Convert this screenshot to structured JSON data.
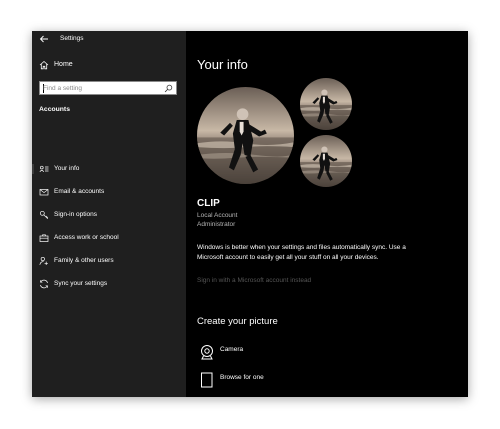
{
  "window": {
    "title": "Settings"
  },
  "sidebar": {
    "home_label": "Home",
    "search": {
      "placeholder": "Find a setting"
    },
    "section_title": "Accounts",
    "items": [
      {
        "label": "Your info",
        "icon": "person-card-icon",
        "selected": true
      },
      {
        "label": "Email & accounts",
        "icon": "mail-icon",
        "selected": false
      },
      {
        "label": "Sign-in options",
        "icon": "key-icon",
        "selected": false
      },
      {
        "label": "Access work or school",
        "icon": "briefcase-icon",
        "selected": false
      },
      {
        "label": "Family & other users",
        "icon": "person-add-icon",
        "selected": false
      },
      {
        "label": "Sync your settings",
        "icon": "sync-icon",
        "selected": false
      }
    ]
  },
  "main": {
    "title": "Your info",
    "user": {
      "name": "CLIP",
      "account_type": "Local Account",
      "role": "Administrator"
    },
    "sync_message": "Windows is better when your settings and files automatically sync. Use a Microsoft account to easily get all your stuff on all your devices.",
    "ms_link": "Sign in with a Microsoft account instead",
    "create_title": "Create your picture",
    "options": [
      {
        "label": "Camera",
        "icon": "camera-icon"
      },
      {
        "label": "Browse for one",
        "icon": "file-icon"
      }
    ]
  },
  "colors": {
    "sidebar_bg": "#1f1f1f",
    "main_bg": "#000000",
    "text": "#ffffff",
    "muted_text": "#b5b5b5",
    "disabled_link": "#555555"
  }
}
